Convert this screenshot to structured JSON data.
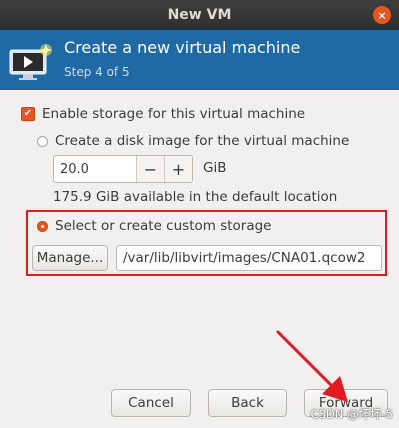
{
  "window": {
    "title": "New VM",
    "close_glyph": "×"
  },
  "header": {
    "title": "Create a new virtual machine",
    "subtitle": "Step 4 of 5",
    "icon": "vm-monitor-icon"
  },
  "storage": {
    "enable_label": "Enable storage for this virtual machine",
    "enable_checked": true,
    "check_glyph": "✔",
    "create_disk_label": "Create a disk image for the virtual machine",
    "create_disk_selected": false,
    "disk_size_value": "20.0",
    "decrement_label": "−",
    "increment_label": "+",
    "unit_label": "GiB",
    "available_text": "175.9 GiB available in the default location",
    "custom_label": "Select or create custom storage",
    "custom_selected": true,
    "manage_label": "Manage...",
    "path_value": "/var/lib/libvirt/images/CNA01.qcow2"
  },
  "footer": {
    "cancel_label": "Cancel",
    "back_label": "Back",
    "forward_label": "Forward"
  },
  "watermark": "CSDN @坏坏-5",
  "colors": {
    "header_bg": "#1f6aa5",
    "accent": "#e95420",
    "highlight": "#e11b22"
  }
}
